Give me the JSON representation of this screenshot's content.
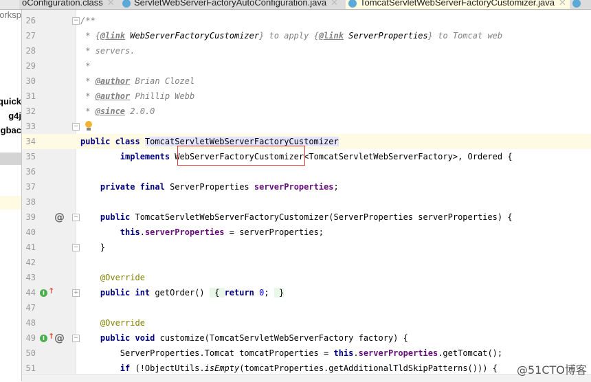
{
  "tabs": [
    {
      "label": "oConfiguration.class",
      "active": false
    },
    {
      "label": "ServletWebServerFactoryAutoConfiguration.java",
      "active": false
    },
    {
      "label": "TomcatServletWebServerFactoryCustomizer.java",
      "active": true
    },
    {
      "label": "",
      "active": false
    }
  ],
  "sidebar": {
    "items": [
      "orksp",
      "quick",
      "g4j",
      "gbac"
    ]
  },
  "editor": {
    "lines": [
      {
        "n": "26",
        "fold": "open",
        "t": [
          [
            "/**",
            "cm"
          ]
        ]
      },
      {
        "n": "27",
        "t": [
          [
            " * {",
            "cm"
          ],
          [
            "@link",
            "tag"
          ],
          [
            " WebServerFactoryCustomizer",
            "ref"
          ],
          [
            "} to apply {",
            "cm"
          ],
          [
            "@link",
            "tag"
          ],
          [
            " ServerProperties",
            "ref"
          ],
          [
            "} to Tomcat web",
            "cm"
          ]
        ]
      },
      {
        "n": "28",
        "t": [
          [
            " * servers.",
            "cm"
          ]
        ]
      },
      {
        "n": "29",
        "t": [
          [
            " *",
            "cm"
          ]
        ]
      },
      {
        "n": "30",
        "t": [
          [
            " * ",
            "cm"
          ],
          [
            "@author",
            "tag"
          ],
          [
            " Brian Clozel",
            "cm"
          ]
        ]
      },
      {
        "n": "31",
        "t": [
          [
            " * ",
            "cm"
          ],
          [
            "@author",
            "tag"
          ],
          [
            " Phillip Webb",
            "cm"
          ]
        ]
      },
      {
        "n": "32",
        "t": [
          [
            " * ",
            "cm"
          ],
          [
            "@since",
            "tag"
          ],
          [
            " 2.0.0",
            "cm"
          ]
        ]
      },
      {
        "n": "33",
        "fold": "close",
        "bulb": true,
        "t": []
      },
      {
        "n": "34",
        "caret": true,
        "t": [
          [
            "public class ",
            "kw"
          ],
          [
            "TomcatServletWebServerFactoryCustomizer",
            "hl"
          ]
        ]
      },
      {
        "n": "35",
        "t": [
          [
            "        "
          ],
          [
            "implements ",
            "kw"
          ],
          [
            "WebServerFactoryCustomizer<TomcatServletWebServerFactory>, Ordered {"
          ]
        ]
      },
      {
        "n": "36",
        "t": []
      },
      {
        "n": "37",
        "t": [
          [
            "    "
          ],
          [
            "private final ",
            "kw"
          ],
          [
            "ServerProperties "
          ],
          [
            "serverProperties",
            "fld"
          ],
          [
            ";"
          ]
        ]
      },
      {
        "n": "38",
        "t": []
      },
      {
        "n": "39",
        "at": true,
        "fold": "open",
        "t": [
          [
            "    "
          ],
          [
            "public ",
            "kw"
          ],
          [
            "TomcatServletWebServerFactoryCustomizer(ServerProperties serverProperties) {"
          ]
        ]
      },
      {
        "n": "40",
        "t": [
          [
            "        "
          ],
          [
            "this",
            "kw"
          ],
          [
            "."
          ],
          [
            "serverProperties",
            "fld"
          ],
          [
            " = serverProperties;"
          ]
        ]
      },
      {
        "n": "41",
        "fold": "close",
        "t": [
          [
            "    }"
          ]
        ]
      },
      {
        "n": "42",
        "t": []
      },
      {
        "n": "43",
        "t": [
          [
            "    "
          ],
          [
            "@Override",
            "ann"
          ]
        ]
      },
      {
        "n": "44",
        "impl": true,
        "fold": "plus",
        "t": [
          [
            "    "
          ],
          [
            "public int ",
            "kw"
          ],
          [
            "getOrder() "
          ],
          [
            " { ",
            "br"
          ],
          [
            "return ",
            "kw"
          ],
          [
            "0",
            "num"
          ],
          [
            "; "
          ],
          [
            " }",
            "br"
          ]
        ]
      },
      {
        "n": "47",
        "t": []
      },
      {
        "n": "48",
        "t": [
          [
            "    "
          ],
          [
            "@Override",
            "ann"
          ]
        ]
      },
      {
        "n": "49",
        "impl": true,
        "at": true,
        "fold": "open",
        "t": [
          [
            "    "
          ],
          [
            "public void ",
            "kw"
          ],
          [
            "customize(TomcatServletWebServerFactory factory) {"
          ]
        ]
      },
      {
        "n": "50",
        "t": [
          [
            "        ServerProperties.Tomcat tomcatProperties = "
          ],
          [
            "this",
            "kw"
          ],
          [
            "."
          ],
          [
            "serverProperties",
            "fld"
          ],
          [
            ".getTomcat();"
          ]
        ]
      },
      {
        "n": "51",
        "t": [
          [
            "        "
          ],
          [
            "if ",
            "kw"
          ],
          [
            "(!ObjectUtils."
          ],
          [
            "isEmpty",
            "st"
          ],
          [
            "(tomcatProperties.getAdditionalTldSkipPatterns())) {"
          ]
        ]
      }
    ]
  },
  "watermark": "@51CTO博客",
  "colors": {
    "keyword": "#000080",
    "field": "#660e7a",
    "comment": "#808080",
    "annotation": "#808000",
    "highlight_box": "#e33333"
  }
}
